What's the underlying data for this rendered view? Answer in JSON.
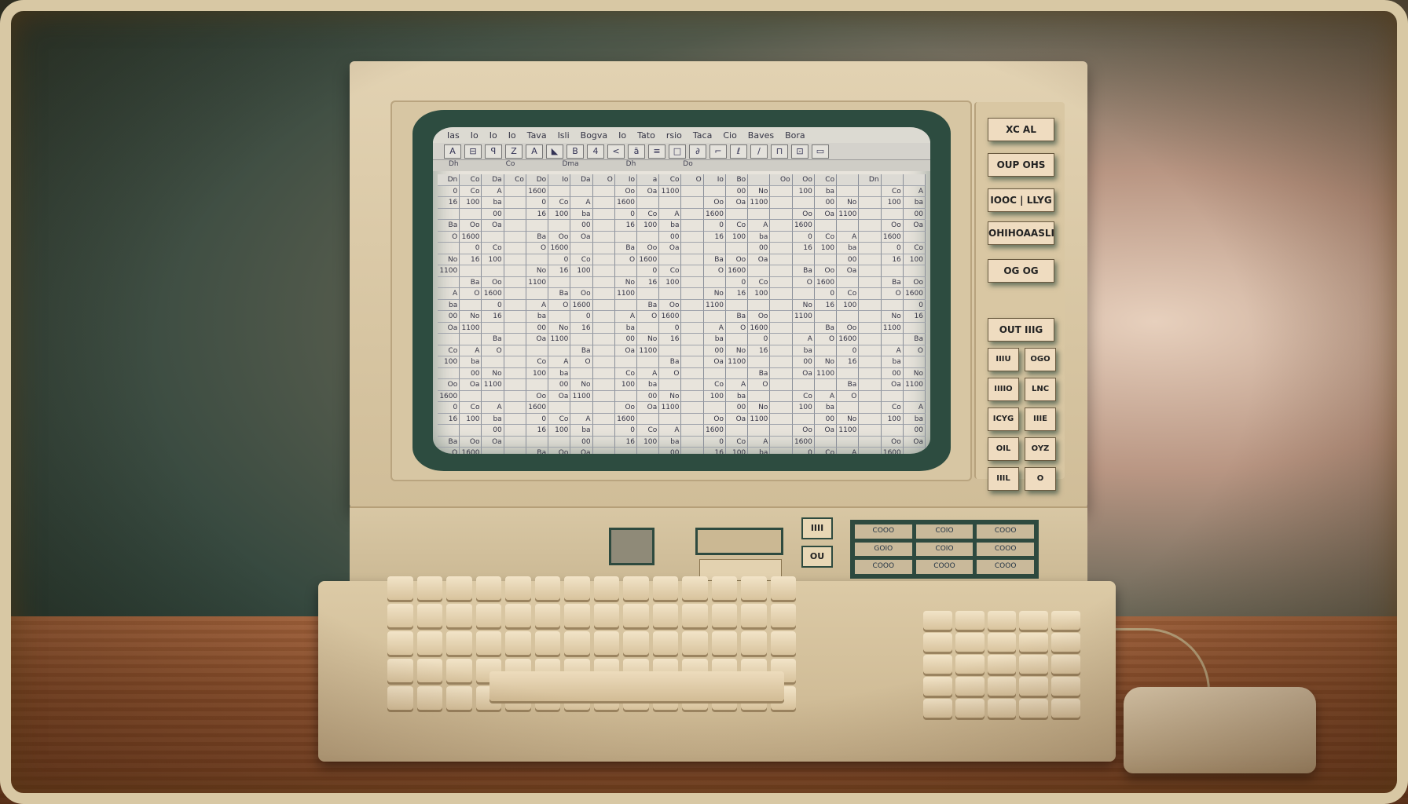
{
  "spreadsheet": {
    "menu": [
      "Ias",
      "Io",
      "Io",
      "Io",
      "Tava",
      "Isli",
      "Bogva",
      "Io",
      "Tato",
      "rsio",
      "Taca",
      "Cio",
      "Baves",
      "Bora"
    ],
    "toolbar": [
      "A",
      "⊟",
      "ꟼ",
      "Z",
      "A",
      "◣",
      "B",
      "4",
      "<",
      "ā",
      "≡",
      "□",
      "∂",
      "⌐",
      "ℓ",
      "/",
      "⊓",
      "⊡",
      "▭"
    ],
    "column_headers": [
      "Dh",
      "Co",
      "Dma",
      "Dh",
      "Do"
    ],
    "header_row": [
      "Dn",
      "Co",
      "Da",
      "Co",
      "Do",
      "Io",
      "Da",
      "O",
      "Io",
      "a",
      "Co",
      "O",
      "Io",
      "Bo",
      "",
      "Oo",
      "Oo",
      "Co",
      "",
      "Dn",
      "",
      ""
    ],
    "cell_samples": [
      "0",
      "00",
      "Ba",
      "Co",
      "No",
      "Oo",
      "A",
      "16",
      "Oa",
      "O",
      "100",
      "1100",
      "1600",
      "ba"
    ]
  },
  "side_panel": {
    "buttons": [
      "XC  AL",
      "OUP  OHS",
      "IOOC | LLYG",
      "OHIHOAASLI",
      "OG  OG",
      "OUT  IIIG",
      "IIIU",
      "OGO",
      "IIIIO",
      "LNC",
      "ICYG",
      "IIIE",
      "OIL",
      "OYZ",
      "IIIL",
      "O"
    ]
  },
  "base_panel": {
    "mini_buttons": [
      "IIII",
      "OU"
    ],
    "bank_buttons": [
      "COOO",
      "COIO",
      "COOO",
      "GOIO",
      "COIO",
      "COOO",
      "COOO",
      "COOO",
      "COOO"
    ]
  }
}
